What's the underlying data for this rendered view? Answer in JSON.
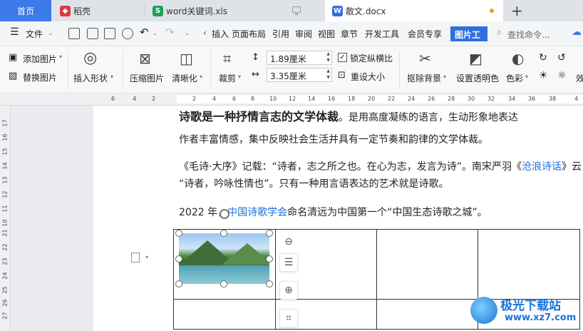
{
  "tabs": {
    "home": "首页",
    "daoke": "稻壳",
    "xls": "word关键词.xls",
    "doc": "散文.docx"
  },
  "menu": {
    "file": "文件",
    "items": [
      "插入",
      "页面布局",
      "引用",
      "审阅",
      "视图",
      "章节",
      "开发工具",
      "会员专享"
    ],
    "active": "图片工具",
    "search": "查找命令..."
  },
  "ribbon": {
    "add_image": "添加图片",
    "replace_image": "替换图片",
    "insert_shape": "插入形状",
    "compress": "压缩图片",
    "sharpen": "清晰化",
    "crop": "裁剪",
    "width_value": "1.89厘米",
    "height_value": "3.35厘米",
    "lock_ratio": "锁定纵横比",
    "reset_size": "重设大小",
    "remove_bg": "抠除背景",
    "transparent": "设置透明色",
    "color": "色彩",
    "effect": "效"
  },
  "ruler": {
    "h_ticks": [
      "6",
      "4",
      "2",
      "2",
      "4",
      "6",
      "8",
      "10",
      "12",
      "14",
      "16",
      "18",
      "20",
      "22",
      "24",
      "26",
      "28",
      "30",
      "32",
      "34",
      "36",
      "38",
      "4"
    ],
    "v_ticks": [
      "17",
      "16",
      "15",
      "14",
      "13",
      "12",
      "11",
      "10",
      "21",
      "22",
      "23",
      "24",
      "25",
      "26",
      "27",
      "28",
      "29",
      "30"
    ]
  },
  "document": {
    "line1_bold": "诗歌是一种抒情言志的文学体裁",
    "line1_rest": "。是用高度凝练的语言，生动形象地表达",
    "line2": "作者丰富情感，集中反映社会生活并具有一定节奏和韵律的文学体裁。",
    "line3_a": "《毛诗·大序》记载：“诗者，志之所之也。在心为志，发言为诗”。南宋严羽《",
    "line3_link": "沧浪诗话",
    "line3_b": "》云：",
    "line4": "“诗者，吟咏性情也”。只有一种用言语表达的艺术就是诗歌。",
    "line5_a": "2022 年，",
    "line5_link": "中国诗歌学会",
    "line5_b": "命名清远为中国第一个“中国生态诗歌之城”。"
  },
  "watermark": {
    "title": "极光下载站",
    "url": "www.xz7.com"
  },
  "colors": {
    "accent": "#2f6fe0",
    "home_tab": "#3b7ae8",
    "link": "#1f6fd4"
  }
}
